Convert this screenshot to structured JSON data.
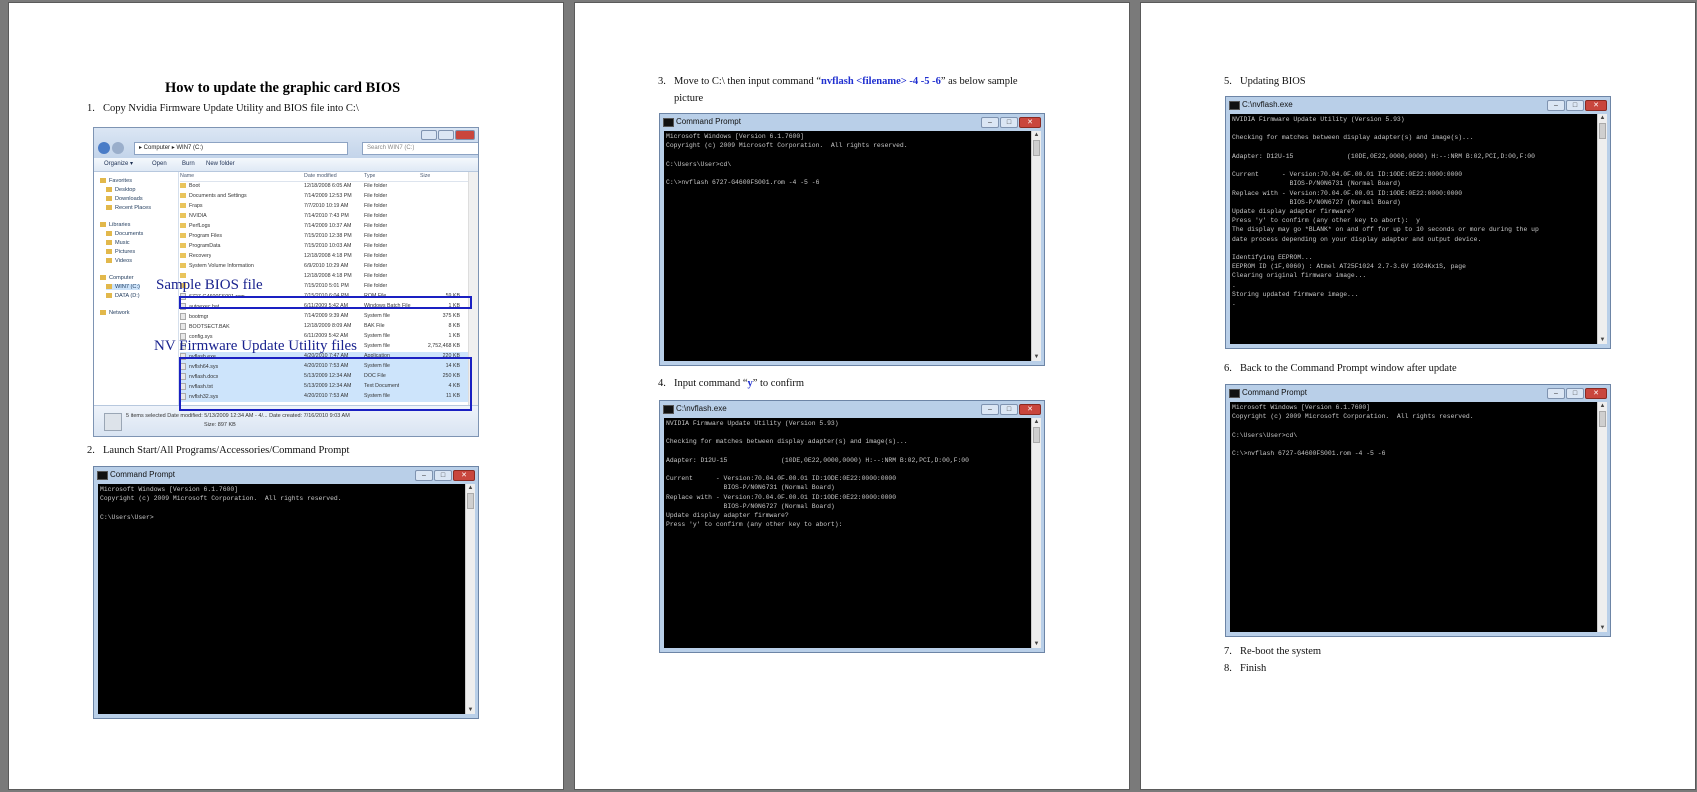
{
  "page1": {
    "title": "How to update the graphic card BIOS",
    "step1": {
      "num": "1.",
      "text": "Copy Nvidia Firmware Update Utility and BIOS file into C:\\"
    },
    "step2": {
      "num": "2.",
      "text": "Launch Start/All Programs/Accessories/Command Prompt"
    },
    "explorer": {
      "path": "▸ Computer ▸ WIN7 (C:)",
      "search_placeholder": "Search WIN7 (C:)",
      "toolbar": [
        "Organize ▾",
        "Open",
        "Burn",
        "New folder"
      ],
      "nav": [
        {
          "label": "Favorites",
          "sel": false
        },
        {
          "label": "Desktop",
          "sel": false
        },
        {
          "label": "Downloads",
          "sel": false
        },
        {
          "label": "Recent Places",
          "sel": false
        },
        {
          "label": "Libraries",
          "sel": false
        },
        {
          "label": "Documents",
          "sel": false
        },
        {
          "label": "Music",
          "sel": false
        },
        {
          "label": "Pictures",
          "sel": false
        },
        {
          "label": "Videos",
          "sel": false
        },
        {
          "label": "Computer",
          "sel": false
        },
        {
          "label": "WIN7 (C:)",
          "sel": true
        },
        {
          "label": "DATA (D:)",
          "sel": false
        },
        {
          "label": "Network",
          "sel": false
        }
      ],
      "columns": [
        "Name",
        "Date modified",
        "Type",
        "Size"
      ],
      "rows": [
        {
          "name": "Boot",
          "date": "12/18/2008 6:05 AM",
          "type": "File folder",
          "size": "",
          "folder": true,
          "sel": false
        },
        {
          "name": "Documents and Settings",
          "date": "7/14/2009 12:53 PM",
          "type": "File folder",
          "size": "",
          "folder": true,
          "sel": false
        },
        {
          "name": "Fraps",
          "date": "7/7/2010 10:19 AM",
          "type": "File folder",
          "size": "",
          "folder": true,
          "sel": false
        },
        {
          "name": "NVIDIA",
          "date": "7/14/2010 7:43 PM",
          "type": "File folder",
          "size": "",
          "folder": true,
          "sel": false
        },
        {
          "name": "PerfLogs",
          "date": "7/14/2009 10:37 AM",
          "type": "File folder",
          "size": "",
          "folder": true,
          "sel": false
        },
        {
          "name": "Program Files",
          "date": "7/15/2010 12:38 PM",
          "type": "File folder",
          "size": "",
          "folder": true,
          "sel": false
        },
        {
          "name": "ProgramData",
          "date": "7/15/2010 10:03 AM",
          "type": "File folder",
          "size": "",
          "folder": true,
          "sel": false
        },
        {
          "name": "Recovery",
          "date": "12/18/2008 4:18 PM",
          "type": "File folder",
          "size": "",
          "folder": true,
          "sel": false
        },
        {
          "name": "System Volume Information",
          "date": "6/9/2010 10:29 AM",
          "type": "File folder",
          "size": "",
          "folder": true,
          "sel": false
        },
        {
          "name": "",
          "date": "12/18/2008 4:18 PM",
          "type": "File folder",
          "size": "",
          "folder": true,
          "sel": false
        },
        {
          "name": "",
          "date": "7/15/2010 5:01 PM",
          "type": "File folder",
          "size": "",
          "folder": true,
          "sel": false
        },
        {
          "name": "6727-G4600FS001.rom",
          "date": "7/15/2010 6:04 PM",
          "type": "ROM File",
          "size": "59 KB",
          "folder": false,
          "sel": false
        },
        {
          "name": "autoexec.bat",
          "date": "6/11/2009 5:42 AM",
          "type": "Windows Batch File",
          "size": "1 KB",
          "folder": false,
          "sel": false
        },
        {
          "name": "bootmgr",
          "date": "7/14/2009 9:39 AM",
          "type": "System file",
          "size": "375 KB",
          "folder": false,
          "sel": false
        },
        {
          "name": "BOOTSECT.BAK",
          "date": "12/18/2009 8:09 AM",
          "type": "BAK File",
          "size": "8 KB",
          "folder": false,
          "sel": false
        },
        {
          "name": "config.sys",
          "date": "6/11/2009 5:42 AM",
          "type": "System file",
          "size": "1 KB",
          "folder": false,
          "sel": false
        },
        {
          "name": "",
          "date": "",
          "type": "System file",
          "size": "2,752,468 KB",
          "folder": false,
          "sel": false
        },
        {
          "name": "nvflash.exe",
          "date": "4/20/2010 7:47 AM",
          "type": "Application",
          "size": "220 KB",
          "folder": false,
          "sel": true
        },
        {
          "name": "nvflsh64.sys",
          "date": "4/20/2010 7:53 AM",
          "type": "System file",
          "size": "14 KB",
          "folder": false,
          "sel": true
        },
        {
          "name": "nvflash.docx",
          "date": "5/13/2009 12:34 AM",
          "type": "DOC File",
          "size": "250 KB",
          "folder": false,
          "sel": true
        },
        {
          "name": "nvflash.txt",
          "date": "5/13/2009 12:34 AM",
          "type": "Text Document",
          "size": "4 KB",
          "folder": false,
          "sel": true
        },
        {
          "name": "nvflsh32.sys",
          "date": "4/20/2010 7:53 AM",
          "type": "System file",
          "size": "11 KB",
          "folder": false,
          "sel": true
        }
      ],
      "status_line1": "5 items selected  Date modified: 5/13/2009 12:34 AM - 4/...  Date created: 7/16/2010 9:03 AM",
      "status_line2": "Size: 897 KB"
    },
    "label_bios": "Sample BIOS file",
    "label_nv": "NV Firmware Update Utility files",
    "cmd2": {
      "title": "Command Prompt",
      "text": "Microsoft Windows [Version 6.1.7600]\nCopyright (c) 2009 Microsoft Corporation.  All rights reserved.\n\nC:\\Users\\User>"
    }
  },
  "page2": {
    "step3": {
      "num": "3.",
      "pre": "Move to C:\\ then input command “",
      "cmd": "nvflash <filename> -4 -5 -6",
      "post": "” as below sample",
      "line2": "picture"
    },
    "cmd3": {
      "title": "Command Prompt",
      "text": "Microsoft Windows [Version 6.1.7600]\nCopyright (c) 2009 Microsoft Corporation.  All rights reserved.\n\nC:\\Users\\User>cd\\\n\nC:\\>nvflash 6727-G4600FS001.rom -4 -5 -6"
    },
    "step4": {
      "num": "4.",
      "pre": "Input command “",
      "cmd": "y",
      "post": "” to confirm"
    },
    "cmd4": {
      "title": "C:\\nvflash.exe",
      "text": "NVIDIA Firmware Update Utility (Version 5.93)\n\nChecking for matches between display adapter(s) and image(s)...\n\nAdapter: D12U-15              (10DE,0E22,0000,0000) H:--:NRM B:02,PCI,D:00,F:00\n\nCurrent      - Version:70.04.0F.00.01 ID:10DE:0E22:0000:0000\n               BIOS-P/N0N6731 (Normal Board)\nReplace with - Version:70.04.0F.00.01 ID:10DE:0E22:0000:0000\n               BIOS-P/N0N6727 (Normal Board)\nUpdate display adapter firmware?\nPress 'y' to confirm (any other key to abort):"
    }
  },
  "page3": {
    "step5": {
      "num": "5.",
      "text": "Updating BIOS"
    },
    "cmd5": {
      "title": "C:\\nvflash.exe",
      "text": "NVIDIA Firmware Update Utility (Version 5.93)\n\nChecking for matches between display adapter(s) and image(s)...\n\nAdapter: D12U-15              (10DE,0E22,0000,0000) H:--:NRM B:02,PCI,D:00,F:00\n\nCurrent      - Version:70.04.0F.00.01 ID:10DE:0E22:0000:0000\n               BIOS-P/N0N6731 (Normal Board)\nReplace with - Version:70.04.0F.00.01 ID:10DE:0E22:0000:0000\n               BIOS-P/N0N6727 (Normal Board)\nUpdate display adapter firmware?\nPress 'y' to confirm (any other key to abort):  y\nThe display may go *BLANK* on and off for up to 10 seconds or more during the up\ndate process depending on your display adapter and output device.\n\nIdentifying EEPROM...\nEEPROM ID (1F,0060) : Atmel AT25F1024 2.7-3.6V 1024Kx1S, page\nClearing original firmware image...\n.\nStoring updated firmware image...\n."
    },
    "step6": {
      "num": "6.",
      "text": "Back to the Command Prompt window after update"
    },
    "cmd6": {
      "title": "Command Prompt",
      "text": "Microsoft Windows [Version 6.1.7600]\nCopyright (c) 2009 Microsoft Corporation.  All rights reserved.\n\nC:\\Users\\User>cd\\\n\nC:\\>nvflash 6727-G4600FS001.rom -4 -5 -6"
    },
    "step7": {
      "num": "7.",
      "text": "Re-boot the system"
    },
    "step8": {
      "num": "8.",
      "text": "Finish"
    }
  },
  "colors": {
    "highlight_box": "#1a20c2",
    "command_text": "#1f2fd0",
    "background": "#7a7a7a"
  }
}
